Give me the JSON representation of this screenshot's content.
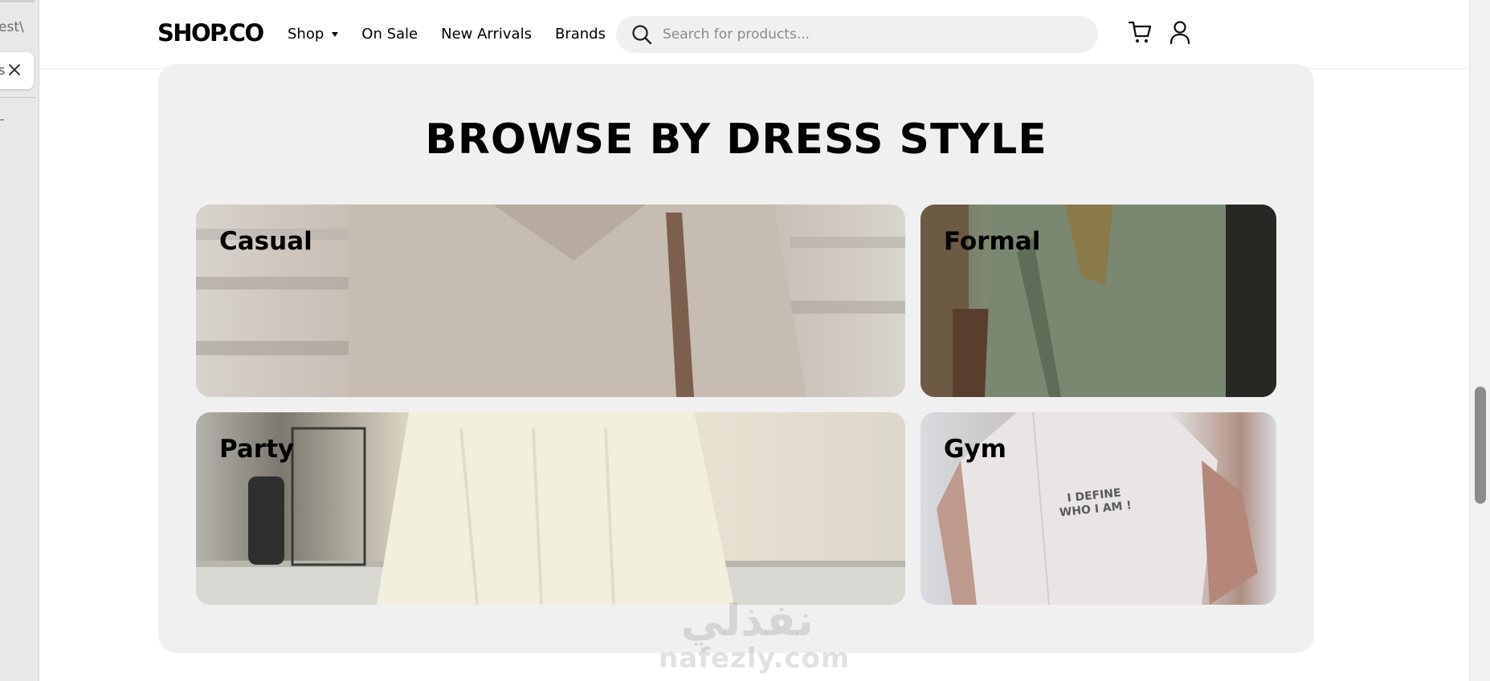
{
  "left_panel": {
    "fragment_top": "est\\",
    "fragment_chip": "s"
  },
  "header": {
    "logo": "SHOP.CO",
    "nav": [
      {
        "label": "Shop",
        "has_dropdown": true
      },
      {
        "label": "On Sale"
      },
      {
        "label": "New Arrivals"
      },
      {
        "label": "Brands"
      }
    ],
    "search": {
      "placeholder": "Search for products...",
      "icon": "search-icon"
    },
    "icons": {
      "cart": "cart-icon",
      "account": "user-icon"
    }
  },
  "section": {
    "title": "BROWSE BY DRESS STYLE",
    "styles": [
      {
        "label": "Casual"
      },
      {
        "label": "Formal"
      },
      {
        "label": "Party"
      },
      {
        "label": "Gym",
        "shirt_text_line1": "I DEFINE",
        "shirt_text_line2": "WHO I AM !"
      }
    ]
  },
  "watermark": {
    "arabic": "نفذلي",
    "latin": "nafezly.com"
  },
  "colors": {
    "panel_bg": "#f0f0f0",
    "search_bg": "#f0f0f0",
    "text": "#000000"
  }
}
